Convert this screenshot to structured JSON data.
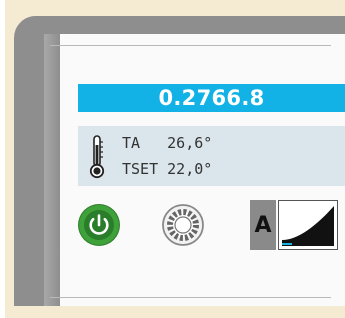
{
  "display": {
    "value": "0.2766.8"
  },
  "temperature": {
    "ta_label": "TA",
    "ta_value": "26,6°",
    "tset_label": "TSET",
    "tset_value": "22,0°"
  },
  "controls": {
    "power_icon": "power-icon",
    "settings_icon": "gear-icon",
    "mode_label": "A",
    "ramp_icon": "ramp-icon"
  },
  "colors": {
    "accent": "#12b2e6",
    "power_green": "#3fa13a",
    "panel_gray": "#8e8e8e",
    "info_bg": "#dbe6ec"
  }
}
